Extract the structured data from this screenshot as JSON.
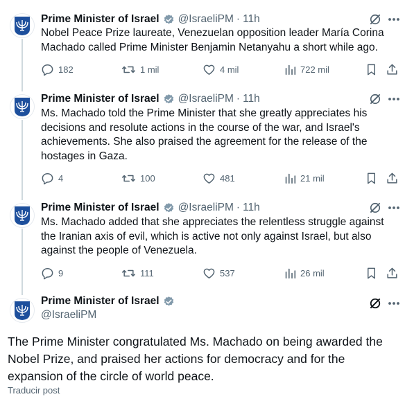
{
  "author": {
    "name": "Prime Minister of Israel",
    "handle": "@IsraeliPM"
  },
  "separator": "·",
  "tweets": [
    {
      "time": "11h",
      "text": "Nobel Peace Prize laureate, Venezuelan opposition leader María Corina Machado called Prime Minister Benjamin Netanyahu a short while ago.",
      "replies": "182",
      "retweets": "1 mil",
      "likes": "4 mil",
      "views": "722 mil"
    },
    {
      "time": "11h",
      "text": "Ms. Machado told the Prime Minister that she greatly appreciates his decisions and resolute actions in the course of the war, and Israel's achievements. She also praised the agreement for the release of the hostages in Gaza.",
      "replies": "4",
      "retweets": "100",
      "likes": "481",
      "views": "21 mil"
    },
    {
      "time": "11h",
      "text": "Ms. Machado added that she appreciates the relentless struggle against the Iranian axis of evil, which is active not only against Israel, but also against the people of Venezuela.",
      "replies": "9",
      "retweets": "111",
      "likes": "537",
      "views": "26 mil"
    }
  ],
  "main_tweet": {
    "text": "The Prime Minister congratulated Ms. Machado on being awarded the Nobel Prize, and praised her actions for democracy and for the expansion of the circle of world peace.",
    "translate_label": "Traducir post"
  },
  "colors": {
    "text": "#0f1419",
    "secondary": "#536471",
    "verified": "#829aab",
    "thread_line": "#cfd9de",
    "emblem": "#1d4f9c"
  },
  "icons": [
    "verified-badge-icon",
    "grok-icon",
    "more-icon",
    "reply-icon",
    "retweet-icon",
    "like-icon",
    "views-icon",
    "bookmark-icon",
    "share-icon",
    "emblem-icon"
  ]
}
